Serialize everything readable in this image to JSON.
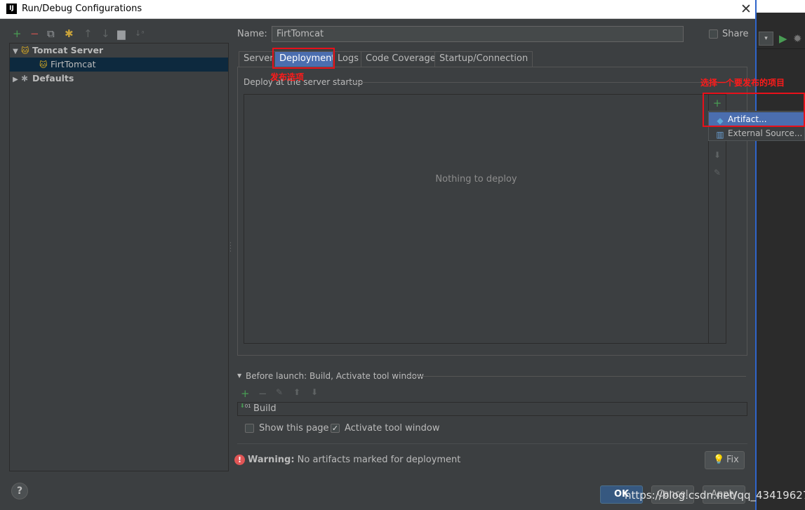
{
  "window": {
    "title": "Run/Debug Configurations",
    "app_icon": "IJ",
    "close_glyph": "✕"
  },
  "left_toolbar": {
    "add": "+",
    "remove": "−",
    "copy": "⧉",
    "settings": "✱",
    "up": "↑",
    "down": "↓",
    "folder": "▆",
    "sort": "↓ᵃ"
  },
  "tree": {
    "group": "Tomcat Server",
    "config": "FirtTomcat",
    "defaults": "Defaults"
  },
  "form": {
    "name_label": "Name:",
    "name_value": "FirtTomcat",
    "share_label": "Share"
  },
  "tabs": [
    "Server",
    "Deployment",
    "Logs",
    "Code Coverage",
    "Startup/Connection"
  ],
  "annotations": {
    "deploy_tab": "发布选项",
    "choose_project": "选择一个要发布的项目"
  },
  "deployment": {
    "section_label": "Deploy at the server startup",
    "empty_text": "Nothing to deploy",
    "toolbar": {
      "add": "+",
      "down": "⬇",
      "edit": "✎"
    }
  },
  "popup": {
    "items": [
      {
        "label": "Artifact...",
        "icon": "artifact-icon"
      },
      {
        "label": "External Source...",
        "icon": "external-source-icon"
      }
    ]
  },
  "before_launch": {
    "label": "Before launch: Build, Activate tool window",
    "toggle_glyph": "▼",
    "toolbar": {
      "add": "+",
      "remove": "−",
      "edit": "✎",
      "up": "⬆",
      "down": "⬇"
    },
    "items": [
      "Build"
    ],
    "build_icon_glyph": "01\n01",
    "show_page_label": "Show this page",
    "show_page_checked": false,
    "activate_label": "Activate tool window",
    "activate_checked": true
  },
  "warning": {
    "glyph": "!",
    "prefix": "Warning:",
    "message": "No artifacts marked for deployment",
    "fix_label": "Fix"
  },
  "buttons": {
    "help": "?",
    "ok": "OK",
    "cancel": "Cancel",
    "apply": "Apply"
  },
  "watermark": "https://blog.csdn.net/qq_43419627",
  "colors": {
    "background": "#3c3f41",
    "selection": "#4b6eaf",
    "annotation": "#e8101a",
    "green": "#499c54",
    "red": "#c75450"
  }
}
